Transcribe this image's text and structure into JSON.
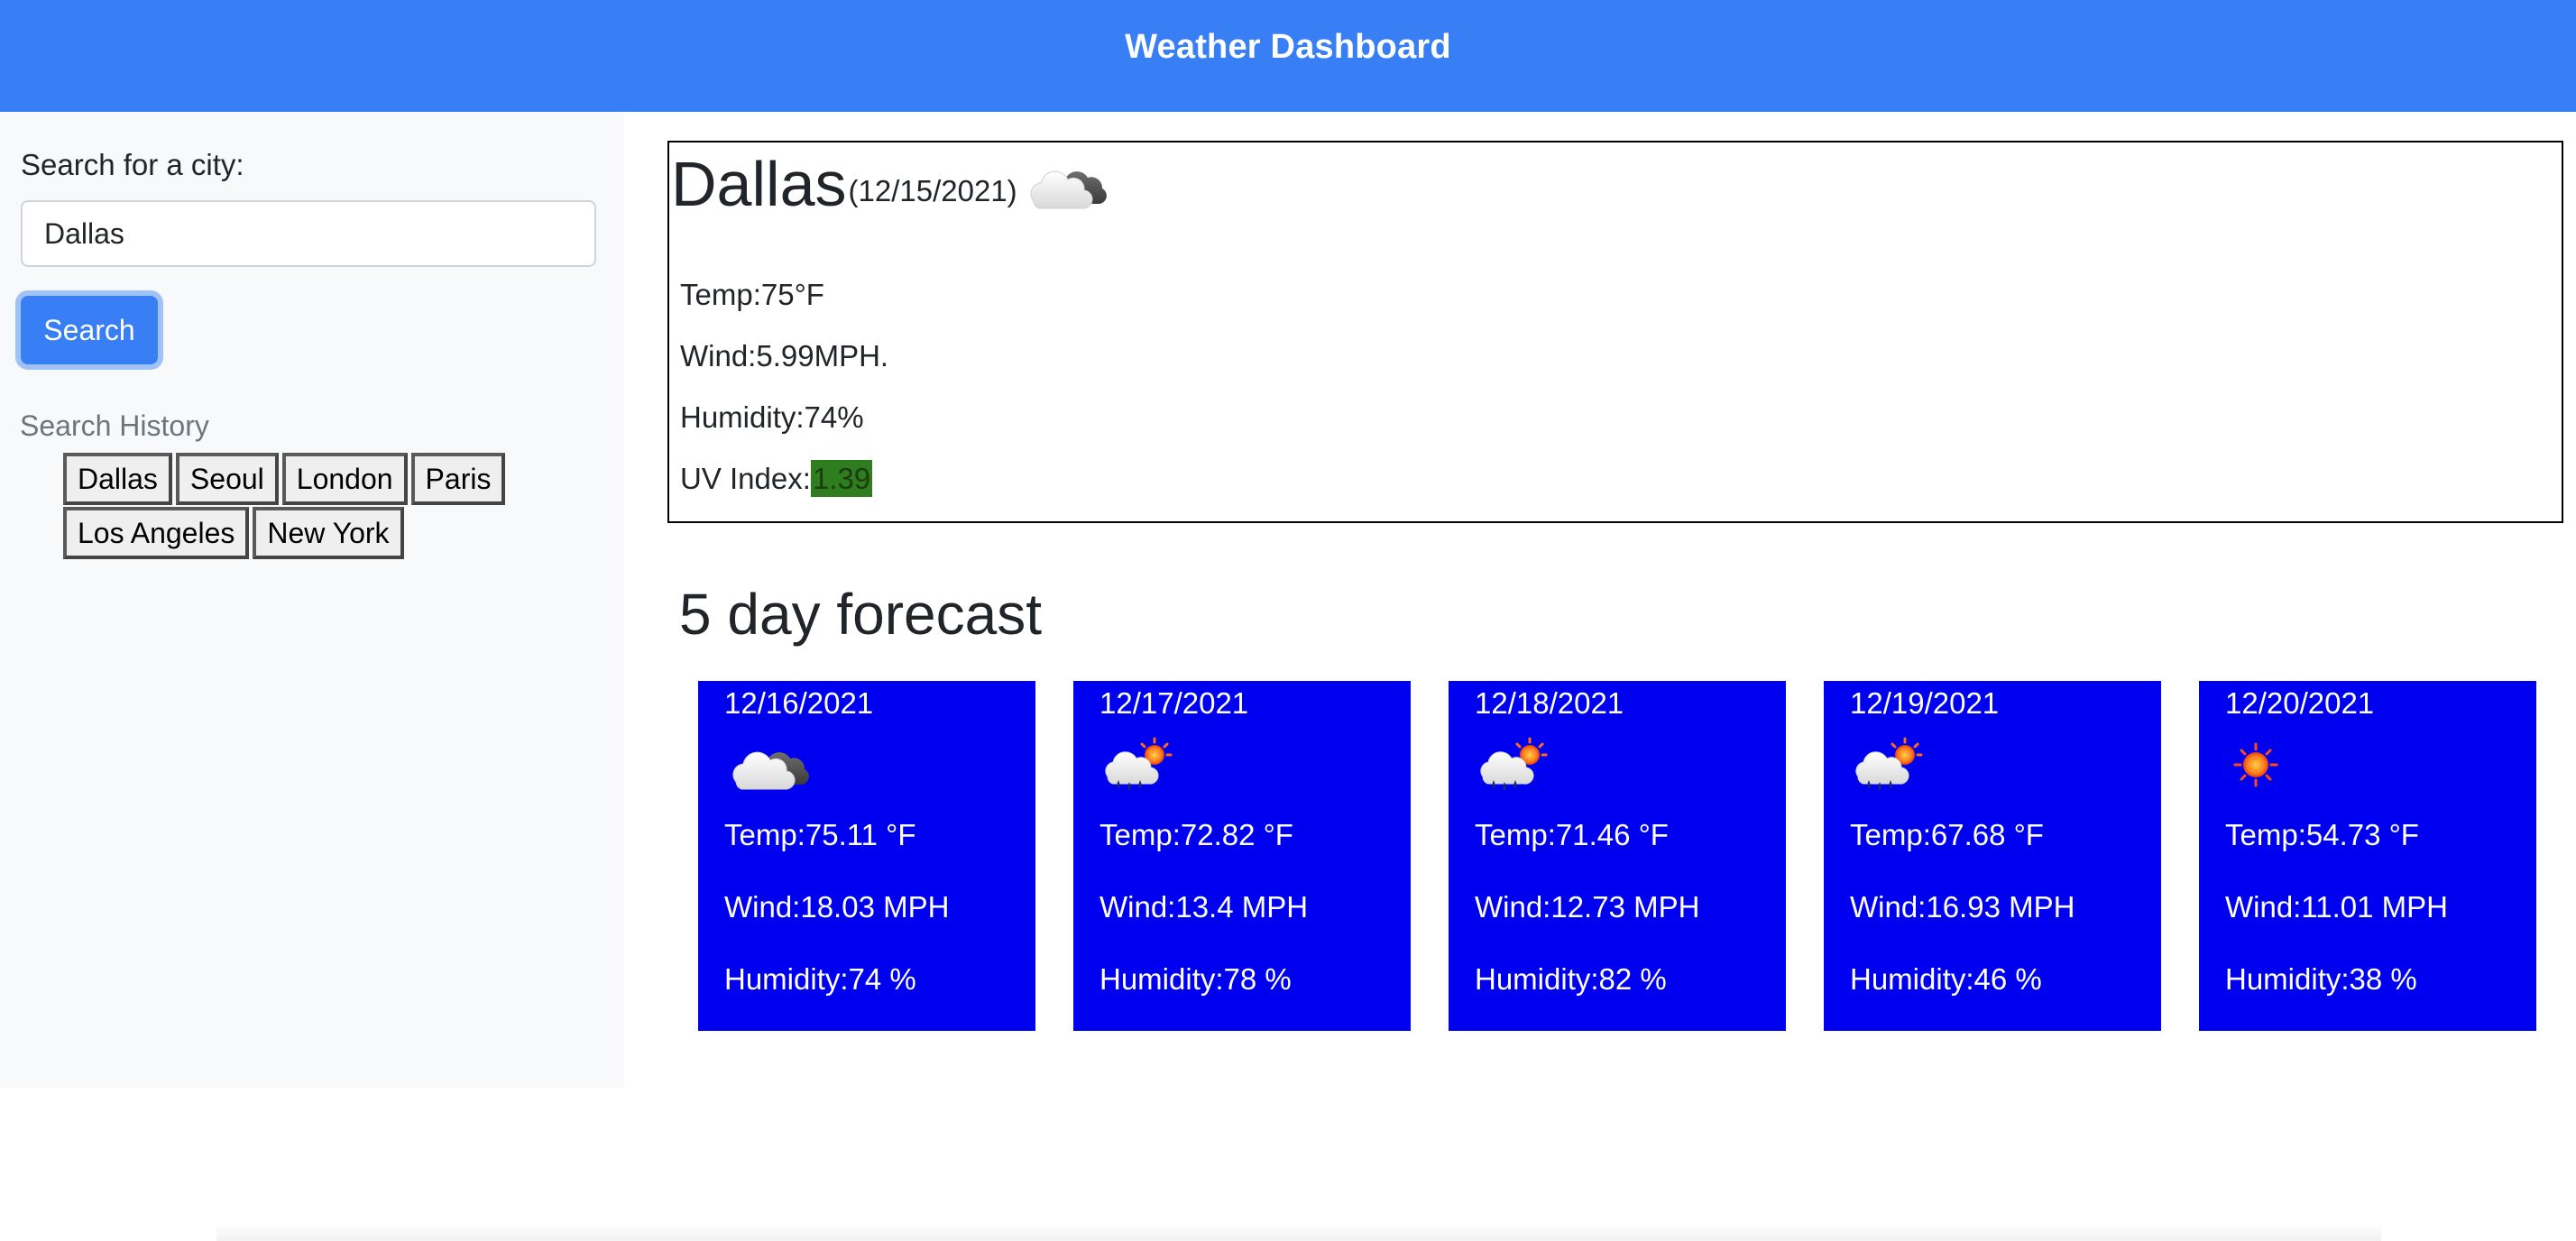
{
  "header": {
    "title": "Weather Dashboard"
  },
  "sidebar": {
    "search_label": "Search for a city:",
    "search_value": "Dallas",
    "search_button": "Search",
    "history_label": "Search History",
    "history": [
      "Dallas",
      "Seoul",
      "London",
      "Paris",
      "Los Angeles",
      "New York"
    ]
  },
  "current": {
    "city": "Dallas",
    "date": "(12/15/2021)",
    "icon": "cloud-icon",
    "temp": "Temp:75°F",
    "wind": "Wind:5.99MPH.",
    "humidity": "Humidity:74%",
    "uv_label": "UV Index:",
    "uv_value": "1.39",
    "uv_color": "#2e7d1f"
  },
  "forecast": {
    "heading": "5 day forecast",
    "card_color": "#0000f0",
    "days": [
      {
        "date": "12/16/2021",
        "icon": "cloud-icon",
        "temp": "Temp:75.11 °F",
        "wind": "Wind:18.03 MPH",
        "humidity": "Humidity:74 %"
      },
      {
        "date": "12/17/2021",
        "icon": "rain-sun-icon",
        "temp": "Temp:72.82 °F",
        "wind": "Wind:13.4 MPH",
        "humidity": "Humidity:78 %"
      },
      {
        "date": "12/18/2021",
        "icon": "rain-sun-icon",
        "temp": "Temp:71.46 °F",
        "wind": "Wind:12.73 MPH",
        "humidity": "Humidity:82 %"
      },
      {
        "date": "12/19/2021",
        "icon": "rain-sun-icon",
        "temp": "Temp:67.68 °F",
        "wind": "Wind:16.93 MPH",
        "humidity": "Humidity:46 %"
      },
      {
        "date": "12/20/2021",
        "icon": "sun-icon",
        "temp": "Temp:54.73 °F",
        "wind": "Wind:11.01 MPH",
        "humidity": "Humidity:38 %"
      }
    ]
  },
  "colors": {
    "header_bg": "#387ef5",
    "sidebar_bg": "#f8f9fa"
  }
}
